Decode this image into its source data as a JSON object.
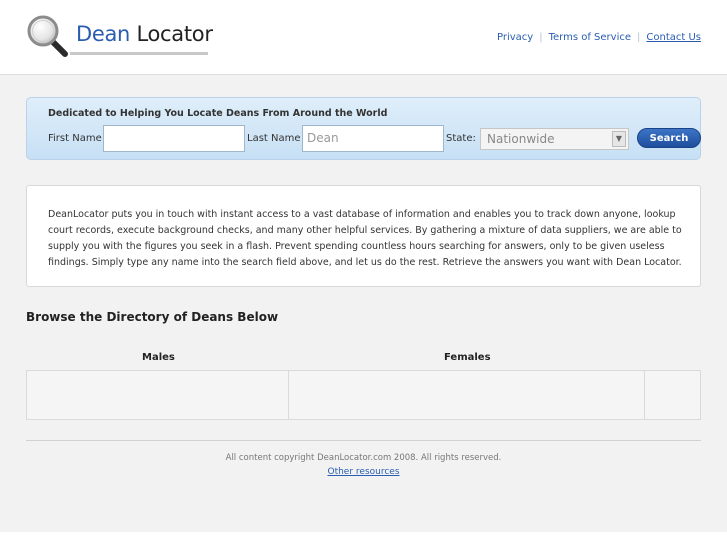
{
  "brand": {
    "name_part1": "Dean",
    "name_part2": "Locator",
    "icon": "magnifier-icon",
    "accent_color": "#2a5db0"
  },
  "top_links": [
    "Privacy",
    "Terms of Service",
    "Contact Us"
  ],
  "search": {
    "title": "Dedicated to Helping You Locate Deans From Around the World",
    "first_name_label": "First Name",
    "first_name_value": "",
    "last_name_label": "Last Name",
    "last_name_value": "Dean",
    "state_label": "State:",
    "state_selected": "Nationwide",
    "button_label": "Search"
  },
  "intro": {
    "text": "DeanLocator puts you in touch with instant access to a vast database of information and enables you to track down anyone, lookup court records, execute background checks, and many other helpful services. By gathering a mixture of data suppliers, we are able to supply you with the figures you seek in a flash. Prevent spending countless hours searching for answers, only to be given useless findings. Simply type any name into the search field above, and let us do the rest. Retrieve the answers you want with Dean Locator."
  },
  "directory": {
    "title": "Browse the Directory of Deans Below",
    "columns": [
      "Males",
      "Females"
    ]
  },
  "footer": {
    "copyright": "All content copyright DeanLocator.com 2008. All rights reserved.",
    "other_link": "Other resources"
  }
}
